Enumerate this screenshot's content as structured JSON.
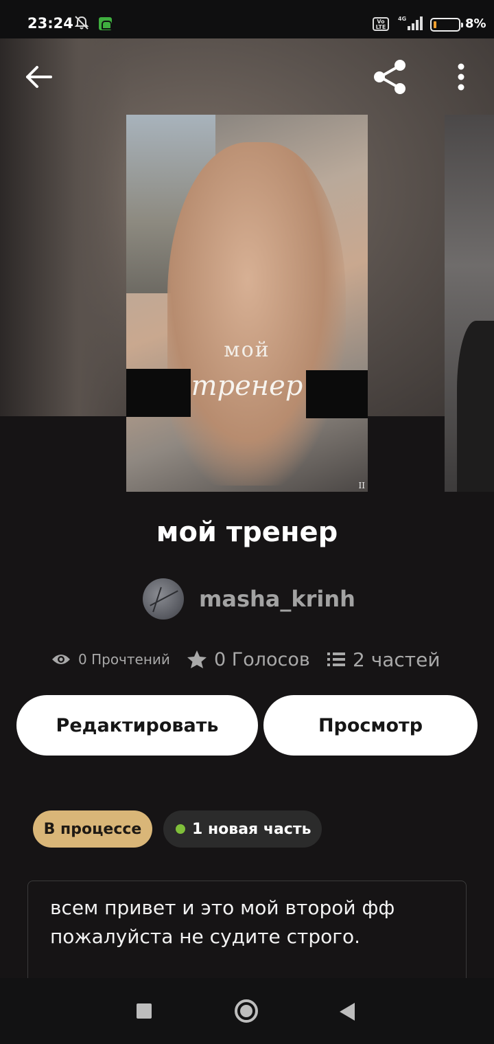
{
  "status_bar": {
    "time": "23:24",
    "volte": "Vo LTE",
    "network": "4G",
    "battery_percent": "8%"
  },
  "toolbar": {
    "back_icon": "arrow-left-icon",
    "share_icon": "share-icon",
    "more_icon": "more-vertical-icon"
  },
  "cover": {
    "title_line1": "мой",
    "title_line2": "тренер",
    "corner_mark": "II"
  },
  "story": {
    "title": "мой тренер",
    "author": "masha_krinh"
  },
  "stats": {
    "reads": "0 Прочтений",
    "votes": "0 Голосов",
    "parts": "2 частей"
  },
  "actions": {
    "edit_label": "Редактировать",
    "view_label": "Просмотр"
  },
  "badges": {
    "status": "В процессе",
    "new_part": "1 новая часть",
    "new_part_color": "#7fbf3a",
    "status_color": "#d9b678"
  },
  "description": {
    "line1": "всем привет и это мой второй фф",
    "line2": "пожалуйста не судите строго."
  },
  "nav": {
    "recent_icon": "recent-apps-icon",
    "home_icon": "home-icon",
    "back_icon": "nav-back-icon"
  }
}
